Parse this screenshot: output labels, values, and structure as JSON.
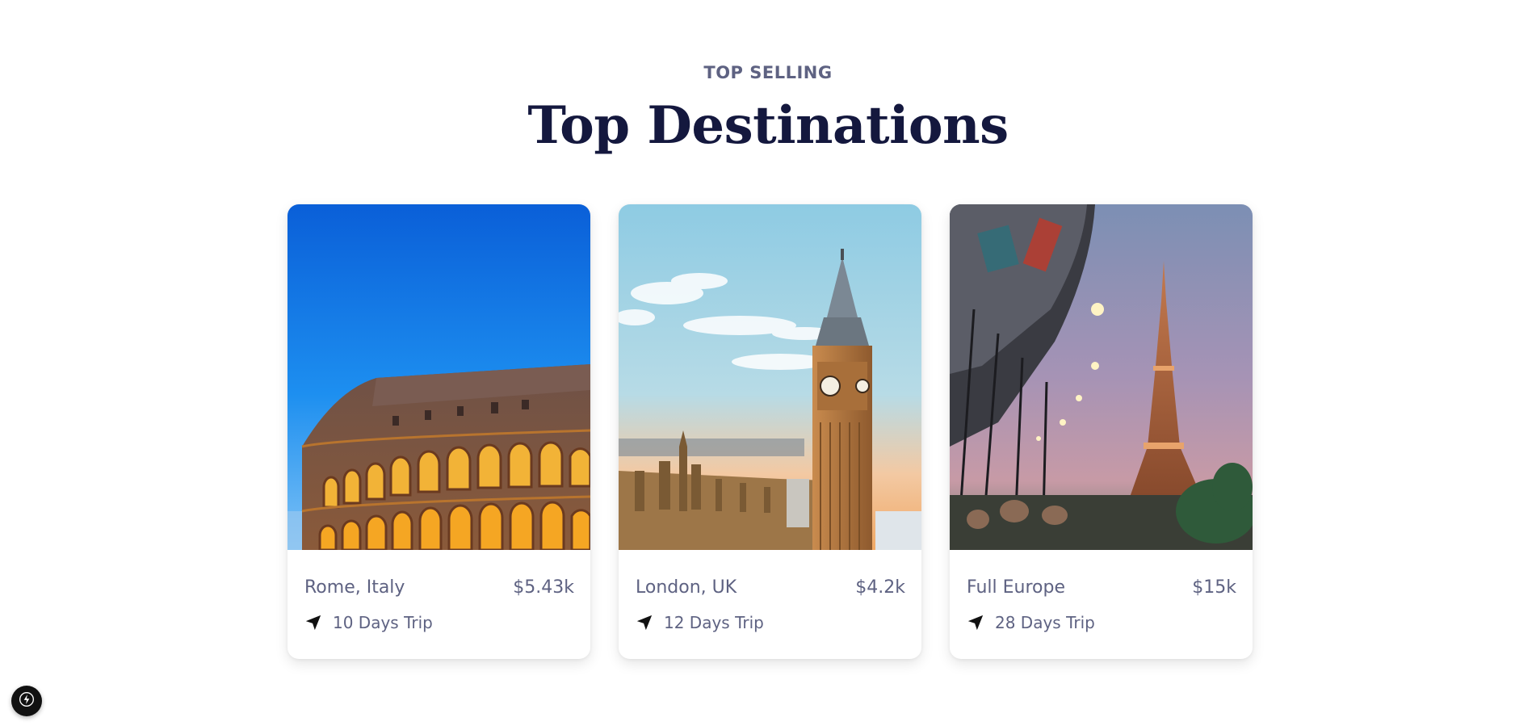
{
  "section": {
    "eyebrow": "TOP SELLING",
    "title": "Top Destinations"
  },
  "destinations": [
    {
      "name": "Rome, Italy",
      "price": "$5.43k",
      "trip": "10 Days Trip",
      "image_icon": "colosseum-image"
    },
    {
      "name": "London, UK",
      "price": "$4.2k",
      "trip": "12 Days Trip",
      "image_icon": "big-ben-image"
    },
    {
      "name": "Full Europe",
      "price": "$15k",
      "trip": "28 Days Trip",
      "image_icon": "eiffel-tower-image"
    }
  ],
  "colors": {
    "title": "#14183e",
    "text": "#5e6282",
    "card_bg": "#ffffff"
  },
  "icons": {
    "trip": "navigation-arrow-icon",
    "dev_badge": "lightning-bolt-icon"
  }
}
